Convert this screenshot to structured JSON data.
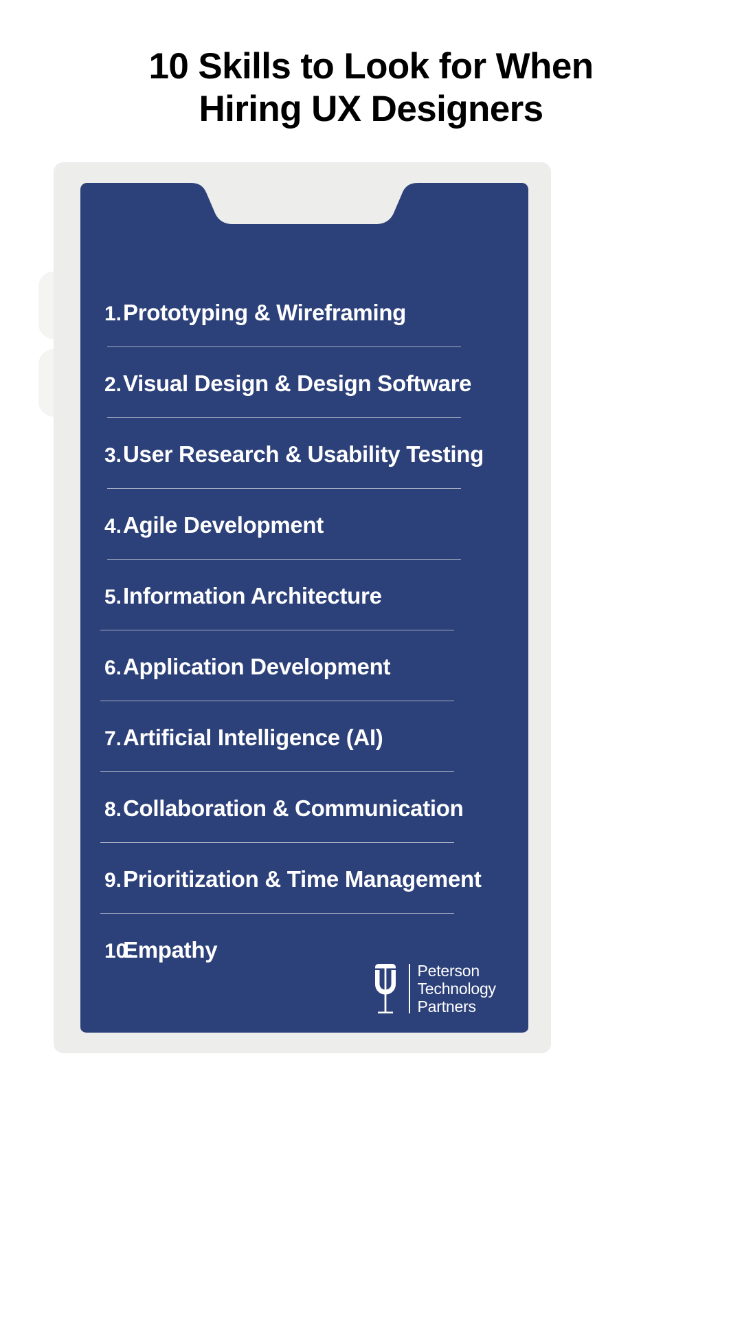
{
  "colors": {
    "page_background": "#FFFFFF",
    "folder_gray": "#EDEDEC",
    "tab_gray": "#F4F4F3",
    "card_navy": "#2C4079",
    "divider": "#A8AFC4",
    "title_text": "#000000",
    "list_text": "#FFFFFF"
  },
  "title": {
    "line1": "10 Skills to Look for When",
    "line2": "Hiring UX Designers"
  },
  "skills": [
    {
      "number": "1.",
      "label": "Prototyping & Wireframing"
    },
    {
      "number": "2.",
      "label": "Visual Design & Design Software"
    },
    {
      "number": "3.",
      "label": "User Research & Usability Testing"
    },
    {
      "number": "4.",
      "label": "Agile Development"
    },
    {
      "number": "5.",
      "label": "Information Architecture"
    },
    {
      "number": "6.",
      "label": "Application Development"
    },
    {
      "number": "7.",
      "label": "Artificial Intelligence (AI)"
    },
    {
      "number": "8.",
      "label": "Collaboration & Communication"
    },
    {
      "number": "9.",
      "label": "Prioritization & Time Management"
    },
    {
      "number": "10.",
      "label": "Empathy"
    }
  ],
  "logo": {
    "mark": "peterson-p-monogram-icon",
    "line1": "Peterson",
    "line2": "Technology",
    "line3": "Partners"
  }
}
